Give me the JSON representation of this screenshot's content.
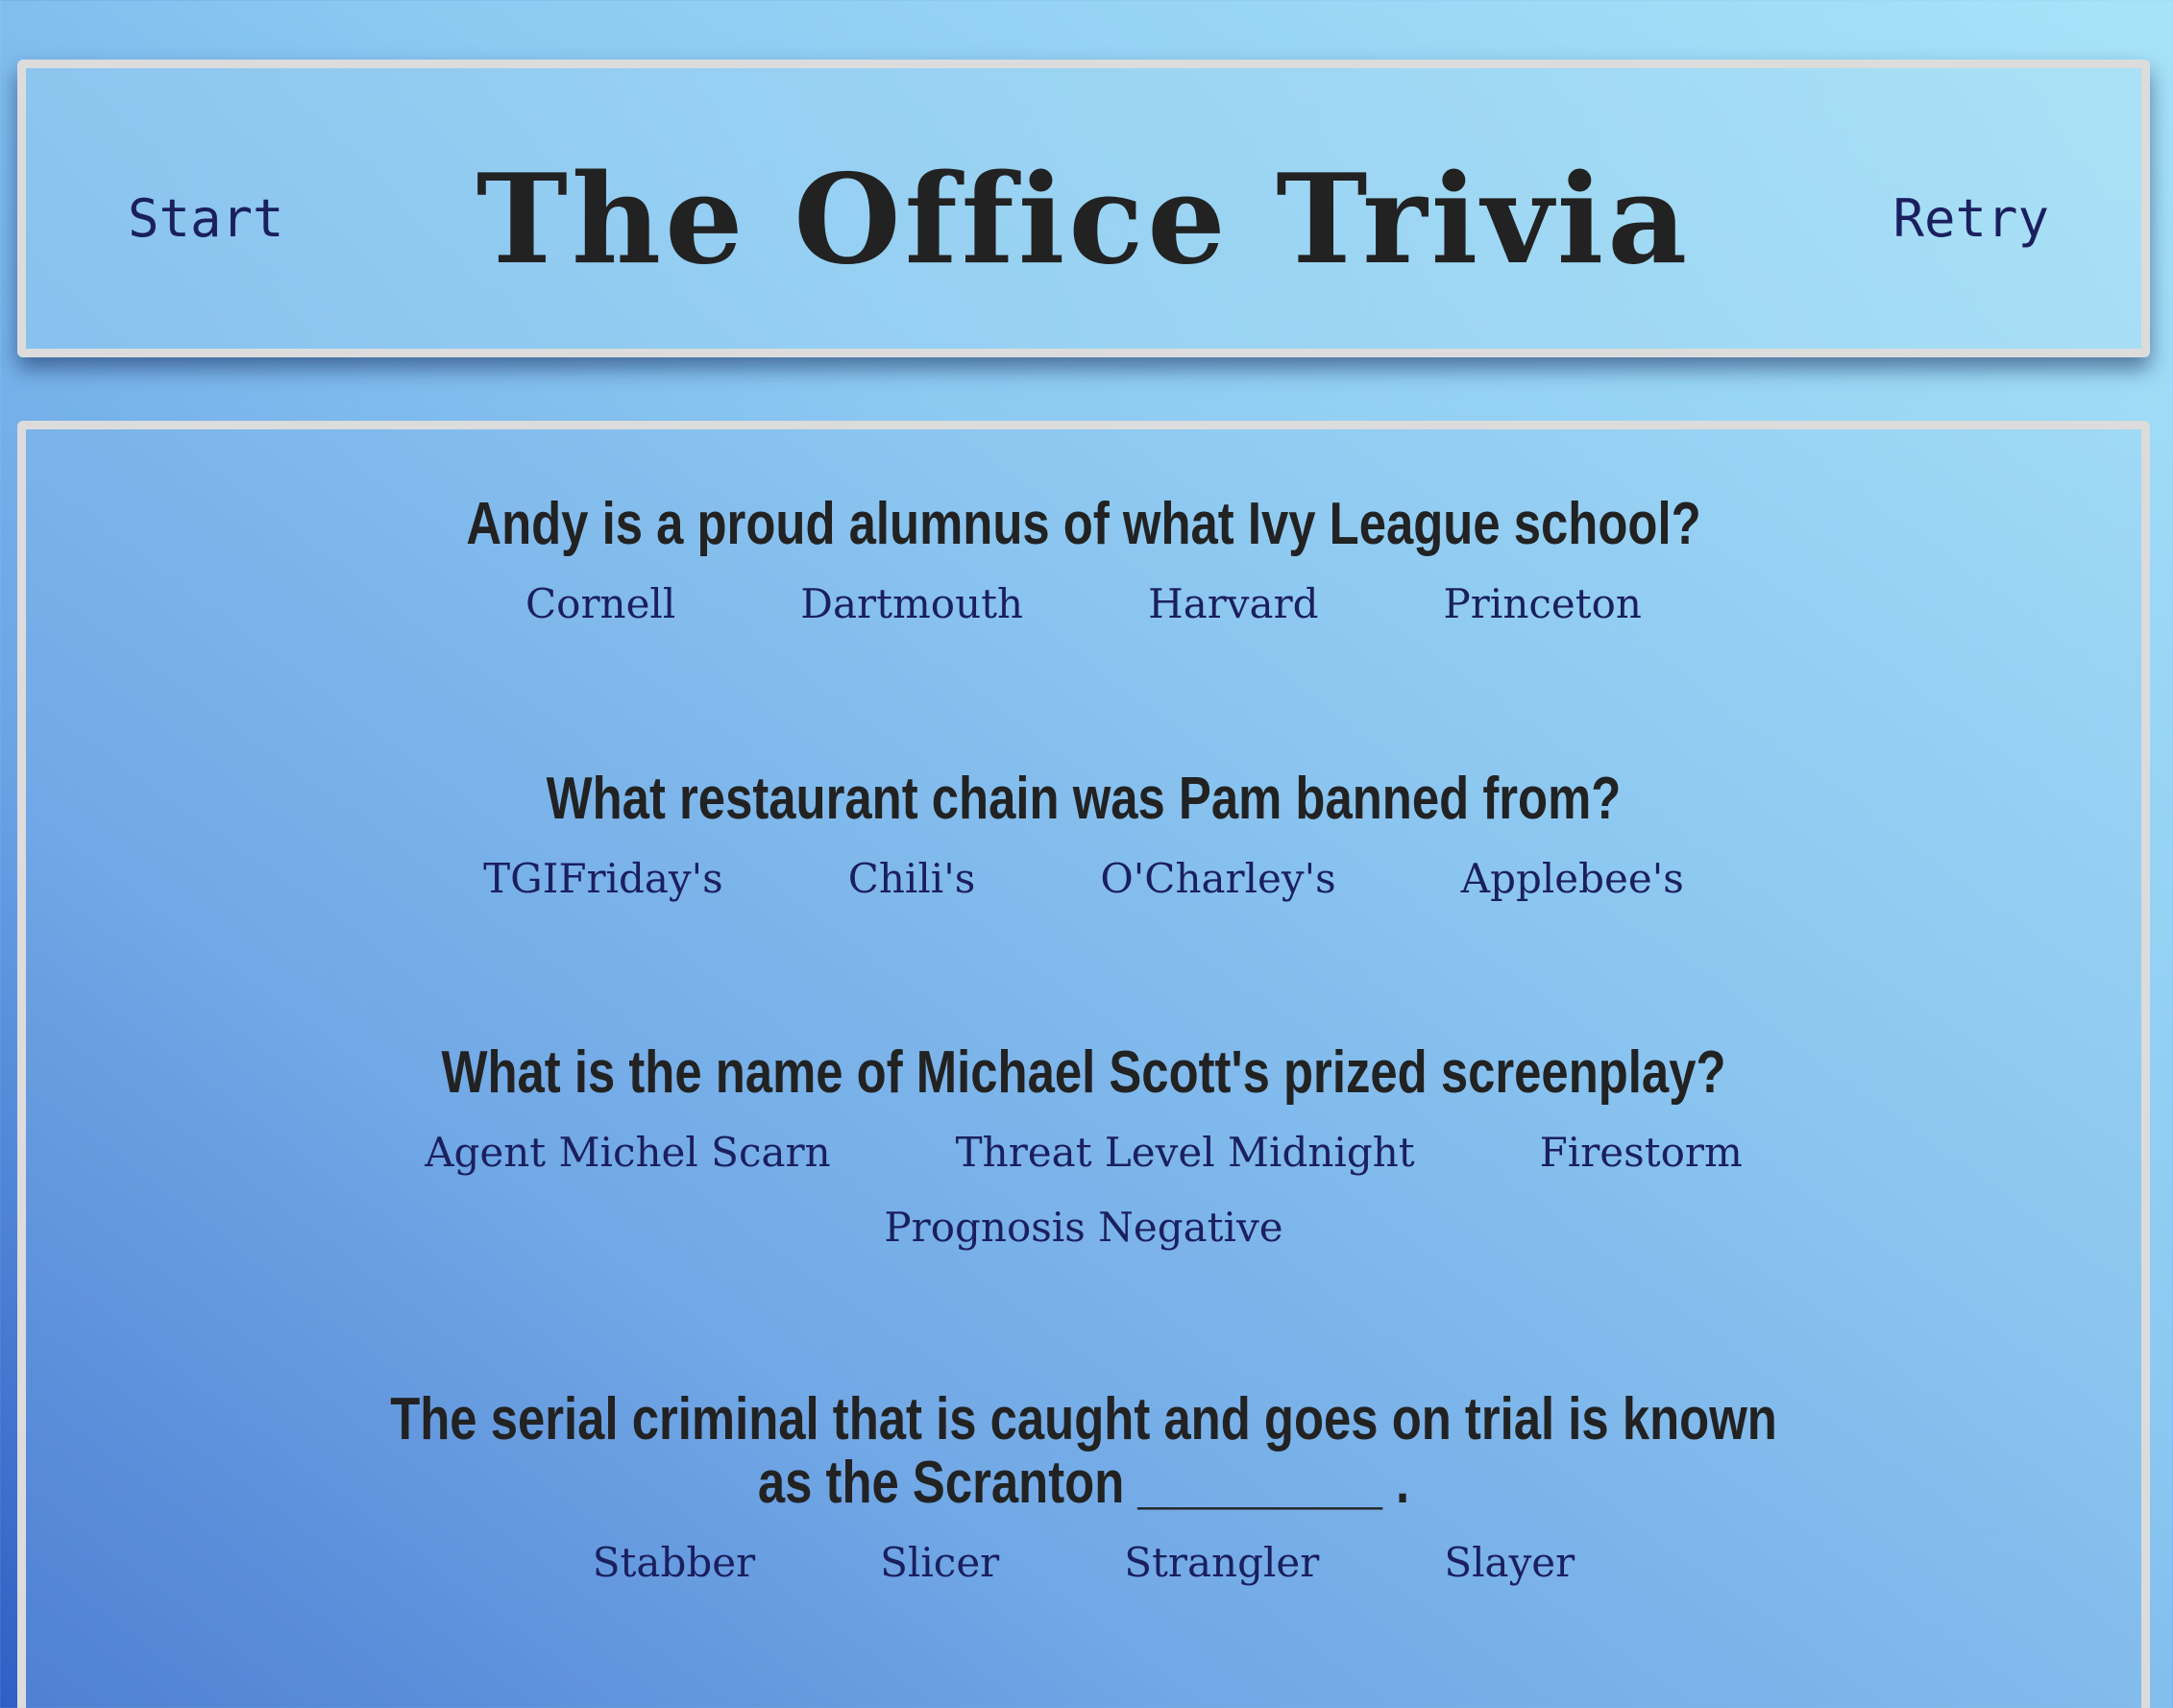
{
  "header": {
    "title": "The Office Trivia",
    "start_label": "Start",
    "retry_label": "Retry"
  },
  "questions": [
    {
      "text": "Andy is a proud alumnus of what Ivy League school?",
      "answers": [
        "Cornell",
        "Dartmouth",
        "Harvard",
        "Princeton"
      ]
    },
    {
      "text": "What restaurant chain was Pam banned from?",
      "answers": [
        "TGIFriday's",
        "Chili's",
        "O'Charley's",
        "Applebee's"
      ]
    },
    {
      "text": "What is the name of Michael Scott's prized screenplay?",
      "answers": [
        "Agent Michel Scarn",
        "Threat Level Midnight",
        "Firestorm",
        "Prognosis Negative"
      ]
    },
    {
      "text": "The serial criminal that is caught and goes on trial is known as the Scranton _________ .",
      "answers": [
        "Stabber",
        "Slicer",
        "Strangler",
        "Slayer"
      ]
    }
  ],
  "colors": {
    "link_text": "#1b1f5e",
    "question_text": "#222222",
    "panel_border": "#dcdcdc"
  }
}
